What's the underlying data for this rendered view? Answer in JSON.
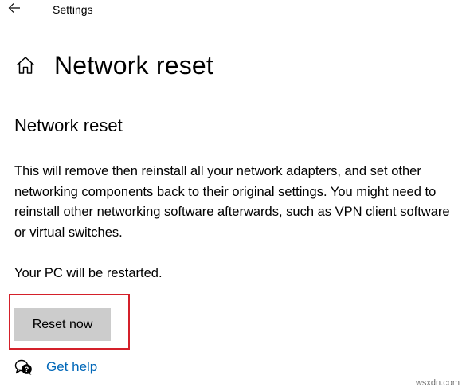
{
  "window": {
    "title": "Settings"
  },
  "header": {
    "page_title": "Network reset"
  },
  "section": {
    "title": "Network reset",
    "description": "This will remove then reinstall all your network adapters, and set other networking components back to their original settings. You might need to reinstall other networking software afterwards, such as VPN client software or virtual switches.",
    "restart_note": "Your PC will be restarted."
  },
  "actions": {
    "reset_label": "Reset now",
    "reset_highlight_color": "#d4202a"
  },
  "help": {
    "label": "Get help",
    "link_color": "#0067b8"
  },
  "icons": {
    "back": "back-arrow-icon",
    "home": "home-icon",
    "help": "chat-help-icon"
  },
  "watermark": {
    "text": "wsxdn.com"
  }
}
